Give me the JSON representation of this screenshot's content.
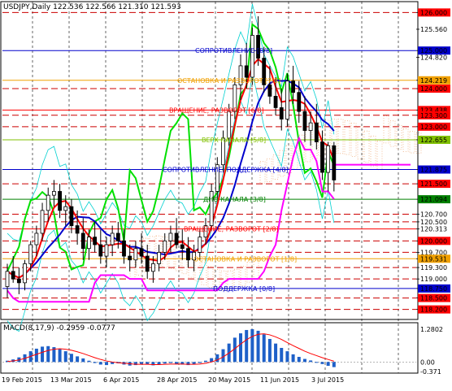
{
  "window": {
    "symbol_line": "USDJPY,Daily  122.536 122.566 121.310 121.593",
    "macd_title": "MACD(8,17,9) -0.2959 -0.0777"
  },
  "chart_data": {
    "type": "candlestick",
    "symbol": "USDJPY",
    "timeframe": "Daily",
    "ohlc_header": {
      "open": 122.536,
      "high": 122.566,
      "low": 121.31,
      "close": 121.593
    },
    "ylim": [
      118.0,
      126.2
    ],
    "x_labels": [
      "19 Feb 2015",
      "13 Mar 2015",
      "6 Apr 2015",
      "28 Apr 2015",
      "20 May 2015",
      "11 Jun 2015",
      "3 Jul 2015"
    ],
    "price_ticks": [
      "126.000",
      "125.560",
      "125.000",
      "124.820",
      "124.219",
      "124.000",
      "123.438",
      "123.300",
      "123.000",
      "122.655",
      "121.875",
      "121.500",
      "121.094",
      "120.700",
      "120.500",
      "120.313",
      "120.000",
      "119.700",
      "119.531",
      "119.300",
      "119.000",
      "118.750",
      "118.500",
      "118.200"
    ],
    "highlight_ticks": [
      {
        "label": "126.000",
        "color": "#ff0000"
      },
      {
        "label": "125.000",
        "color": "#0000cc"
      },
      {
        "label": "124.219",
        "color": "#f0a000"
      },
      {
        "label": "124.000",
        "color": "#ff0000"
      },
      {
        "label": "123.438",
        "color": "#ff0000"
      },
      {
        "label": "123.300",
        "color": "#ff0000"
      },
      {
        "label": "123.000",
        "color": "#ff0000"
      },
      {
        "label": "122.655",
        "color": "#80c000"
      },
      {
        "label": "121.875",
        "color": "#0000cc"
      },
      {
        "label": "121.500",
        "color": "#ff0000"
      },
      {
        "label": "121.094",
        "color": "#008000"
      },
      {
        "label": "120.000",
        "color": "#ff0000"
      },
      {
        "label": "119.531",
        "color": "#f0a000"
      },
      {
        "label": "118.750",
        "color": "#0000cc"
      },
      {
        "label": "118.500",
        "color": "#ff0000"
      },
      {
        "label": "118.200",
        "color": "#ff0000"
      }
    ],
    "murray_levels": [
      {
        "price": 125.0,
        "label": "СОПРОТИВЛЕНИЕ [8/8]",
        "color": "#0000cc"
      },
      {
        "price": 124.219,
        "label": "ОСТАНОВКА И РАЗВОРОТ [7/8]",
        "color": "#f0a000"
      },
      {
        "price": 123.438,
        "label": "ВРАЩЕНИЕ, РАЗВОРОТ [6/8]",
        "color": "#ff0000"
      },
      {
        "price": 122.655,
        "label": "ВЕРХ КАНАЛА [5/8]",
        "color": "#80c000"
      },
      {
        "price": 121.875,
        "label": "СОПРОТИВЛЕНИЕ, ПОДДЕРЖКА [4/8]",
        "color": "#0000cc"
      },
      {
        "price": 121.094,
        "label": "ДНО КАНАЛА [3/8]",
        "color": "#008000"
      },
      {
        "price": 120.313,
        "label": "ВРАЩЕНИЕ, РАЗВОРОТ [2/8]",
        "color": "#ff0000"
      },
      {
        "price": 119.531,
        "label": "ОСТАНОВКА И РАЗВОРОТ [1/8]",
        "color": "#f0a000"
      },
      {
        "price": 118.75,
        "label": "ПОДДЕРЖКА [0/8]",
        "color": "#0000cc"
      }
    ],
    "red_dashed_levels": [
      126.0,
      124.0,
      123.3,
      123.0,
      121.5,
      121.875,
      120.7,
      120.5,
      120.0,
      119.7,
      119.3,
      119.0,
      118.5,
      118.2
    ],
    "candles": [
      [
        118.8,
        119.4,
        118.5,
        119.2
      ],
      [
        119.2,
        119.6,
        118.9,
        119.0
      ],
      [
        119.0,
        119.3,
        118.6,
        118.9
      ],
      [
        118.9,
        119.5,
        118.7,
        119.4
      ],
      [
        119.4,
        120.0,
        119.2,
        119.9
      ],
      [
        119.9,
        120.4,
        119.6,
        120.2
      ],
      [
        120.2,
        121.0,
        120.0,
        120.8
      ],
      [
        120.8,
        121.4,
        120.5,
        121.2
      ],
      [
        121.2,
        121.6,
        120.9,
        121.3
      ],
      [
        121.3,
        121.5,
        120.6,
        120.8
      ],
      [
        120.8,
        121.2,
        120.4,
        120.9
      ],
      [
        120.9,
        121.1,
        120.2,
        120.4
      ],
      [
        120.4,
        120.8,
        119.9,
        120.2
      ],
      [
        120.2,
        120.6,
        119.5,
        119.8
      ],
      [
        119.8,
        120.3,
        119.5,
        120.1
      ],
      [
        120.1,
        120.5,
        119.7,
        119.9
      ],
      [
        119.9,
        120.3,
        119.4,
        119.6
      ],
      [
        119.6,
        120.1,
        119.3,
        119.9
      ],
      [
        119.9,
        120.4,
        119.6,
        120.2
      ],
      [
        120.2,
        120.5,
        119.8,
        120.0
      ],
      [
        120.0,
        120.3,
        119.4,
        119.6
      ],
      [
        119.6,
        119.9,
        119.2,
        119.5
      ],
      [
        119.5,
        120.0,
        119.3,
        119.8
      ],
      [
        119.8,
        120.2,
        119.4,
        119.6
      ],
      [
        119.6,
        119.9,
        119.0,
        119.2
      ],
      [
        119.2,
        119.6,
        118.9,
        119.4
      ],
      [
        119.4,
        119.9,
        119.2,
        119.7
      ],
      [
        119.7,
        120.2,
        119.5,
        120.0
      ],
      [
        120.0,
        120.4,
        119.7,
        120.2
      ],
      [
        120.2,
        120.6,
        119.8,
        119.9
      ],
      [
        119.9,
        120.3,
        119.5,
        119.8
      ],
      [
        119.8,
        120.1,
        119.3,
        119.5
      ],
      [
        119.5,
        119.9,
        119.2,
        119.7
      ],
      [
        119.7,
        120.3,
        119.5,
        120.1
      ],
      [
        120.1,
        120.6,
        119.9,
        120.4
      ],
      [
        120.4,
        121.5,
        120.3,
        121.3
      ],
      [
        121.3,
        122.2,
        121.1,
        122.0
      ],
      [
        122.0,
        122.9,
        121.8,
        122.7
      ],
      [
        122.7,
        123.6,
        122.5,
        123.4
      ],
      [
        123.4,
        124.3,
        123.2,
        124.1
      ],
      [
        124.1,
        124.9,
        123.7,
        124.6
      ],
      [
        124.6,
        125.2,
        124.0,
        124.3
      ],
      [
        124.3,
        125.6,
        124.1,
        125.4
      ],
      [
        125.4,
        125.9,
        124.6,
        124.8
      ],
      [
        124.8,
        125.1,
        123.9,
        124.1
      ],
      [
        124.1,
        124.6,
        123.6,
        123.8
      ],
      [
        123.8,
        124.3,
        123.3,
        123.5
      ],
      [
        123.5,
        124.0,
        122.9,
        123.2
      ],
      [
        123.2,
        124.4,
        123.0,
        124.2
      ],
      [
        124.2,
        124.6,
        123.6,
        123.9
      ],
      [
        123.9,
        124.2,
        123.1,
        123.4
      ],
      [
        123.4,
        123.8,
        122.6,
        122.9
      ],
      [
        122.9,
        123.4,
        122.5,
        123.1
      ],
      [
        123.1,
        123.6,
        122.4,
        122.6
      ],
      [
        122.6,
        122.9,
        121.6,
        121.8
      ],
      [
        121.8,
        122.6,
        121.3,
        122.5
      ],
      [
        122.5,
        122.6,
        121.3,
        121.6
      ]
    ],
    "macd": {
      "ylim": [
        -0.371,
        1.2802
      ],
      "tick_labels": [
        "1.2802",
        "0.00",
        "-0.371"
      ],
      "histogram": [
        0.05,
        0.1,
        0.18,
        0.3,
        0.42,
        0.52,
        0.6,
        0.62,
        0.58,
        0.5,
        0.42,
        0.32,
        0.22,
        0.14,
        0.05,
        -0.04,
        -0.1,
        -0.12,
        -0.08,
        -0.05,
        -0.1,
        -0.14,
        -0.12,
        -0.08,
        -0.1,
        -0.13,
        -0.1,
        -0.06,
        -0.04,
        -0.08,
        -0.1,
        -0.12,
        -0.1,
        -0.04,
        0.05,
        0.15,
        0.3,
        0.5,
        0.72,
        0.95,
        1.12,
        1.25,
        1.28,
        1.22,
        1.08,
        0.9,
        0.72,
        0.55,
        0.42,
        0.3,
        0.2,
        0.12,
        0.06,
        0.0,
        -0.08,
        -0.15,
        -0.2
      ],
      "signal": [
        0.02,
        0.04,
        0.08,
        0.14,
        0.22,
        0.3,
        0.38,
        0.45,
        0.5,
        0.52,
        0.5,
        0.46,
        0.4,
        0.33,
        0.25,
        0.17,
        0.1,
        0.04,
        0.0,
        -0.03,
        -0.05,
        -0.07,
        -0.09,
        -0.09,
        -0.09,
        -0.1,
        -0.1,
        -0.09,
        -0.08,
        -0.08,
        -0.08,
        -0.09,
        -0.09,
        -0.08,
        -0.05,
        0.0,
        0.08,
        0.2,
        0.35,
        0.52,
        0.7,
        0.87,
        1.0,
        1.08,
        1.1,
        1.06,
        0.98,
        0.88,
        0.76,
        0.64,
        0.53,
        0.42,
        0.33,
        0.25,
        0.17,
        0.1,
        0.03
      ],
      "colors": {
        "histogram": "#1e60c8",
        "signal": "#ff0000"
      }
    },
    "colors": {
      "bull": "#000000",
      "bear": "#000000",
      "price_line": "#c0c0c0",
      "green_line": "#00e000",
      "red_line": "#ff0000",
      "blue_line": "#0000cc",
      "magenta_line": "#ff00ff",
      "cyan_band": "#00d0d0",
      "cloud": "#f0b080"
    }
  }
}
